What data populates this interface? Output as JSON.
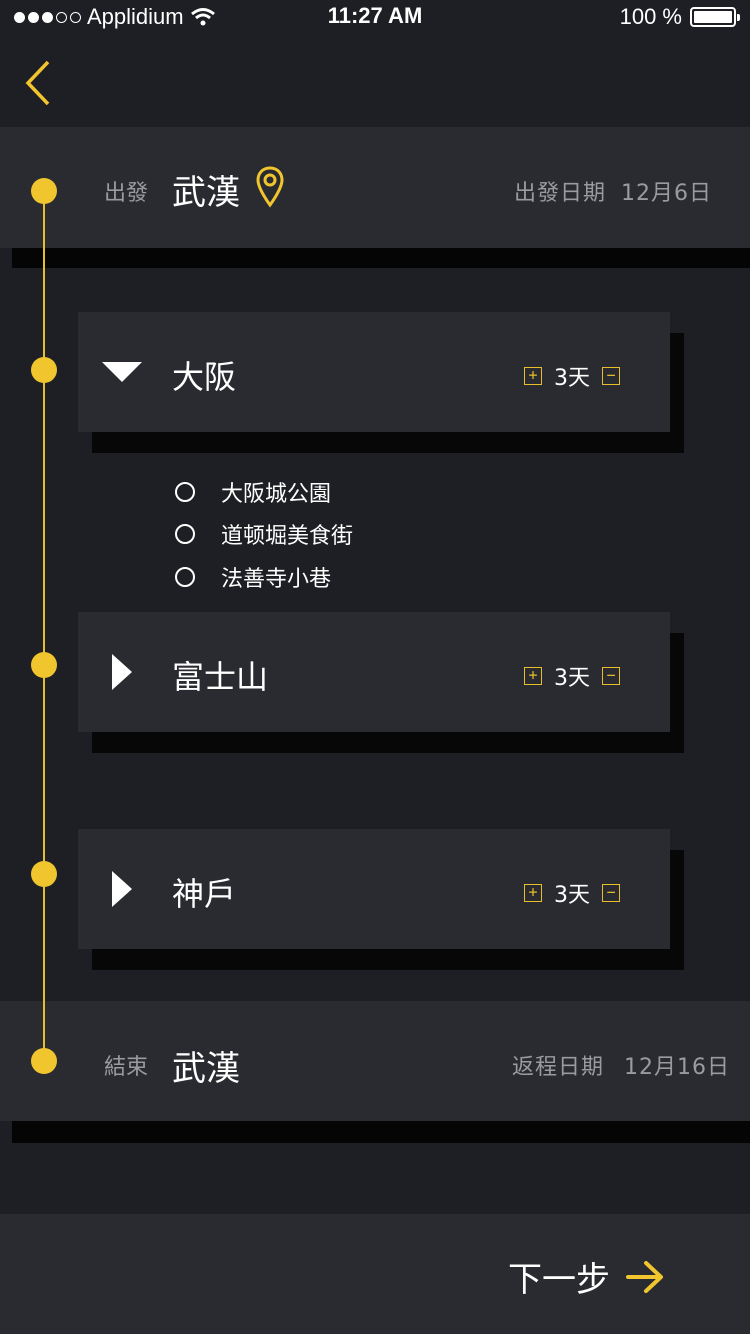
{
  "status": {
    "carrier": "Applidium",
    "time": "11:27 AM",
    "battery": "100 %"
  },
  "start": {
    "label": "出發",
    "city": "武漢",
    "date_label": "出發日期",
    "date": "12月6日"
  },
  "stops": [
    {
      "name": "大阪",
      "days": "3天",
      "expanded": true,
      "items": [
        "大阪城公園",
        "道顿堀美食街",
        "法善寺小巷"
      ]
    },
    {
      "name": "富士山",
      "days": "3天",
      "expanded": false,
      "items": []
    },
    {
      "name": "神戶",
      "days": "3天",
      "expanded": false,
      "items": []
    }
  ],
  "end": {
    "label": "結束",
    "city": "武漢",
    "date_label": "返程日期",
    "date": "12月16日"
  },
  "next_label": "下一步",
  "colors": {
    "accent": "#f0c52d",
    "background": "#1e1f24",
    "panel": "#2a2b31"
  }
}
